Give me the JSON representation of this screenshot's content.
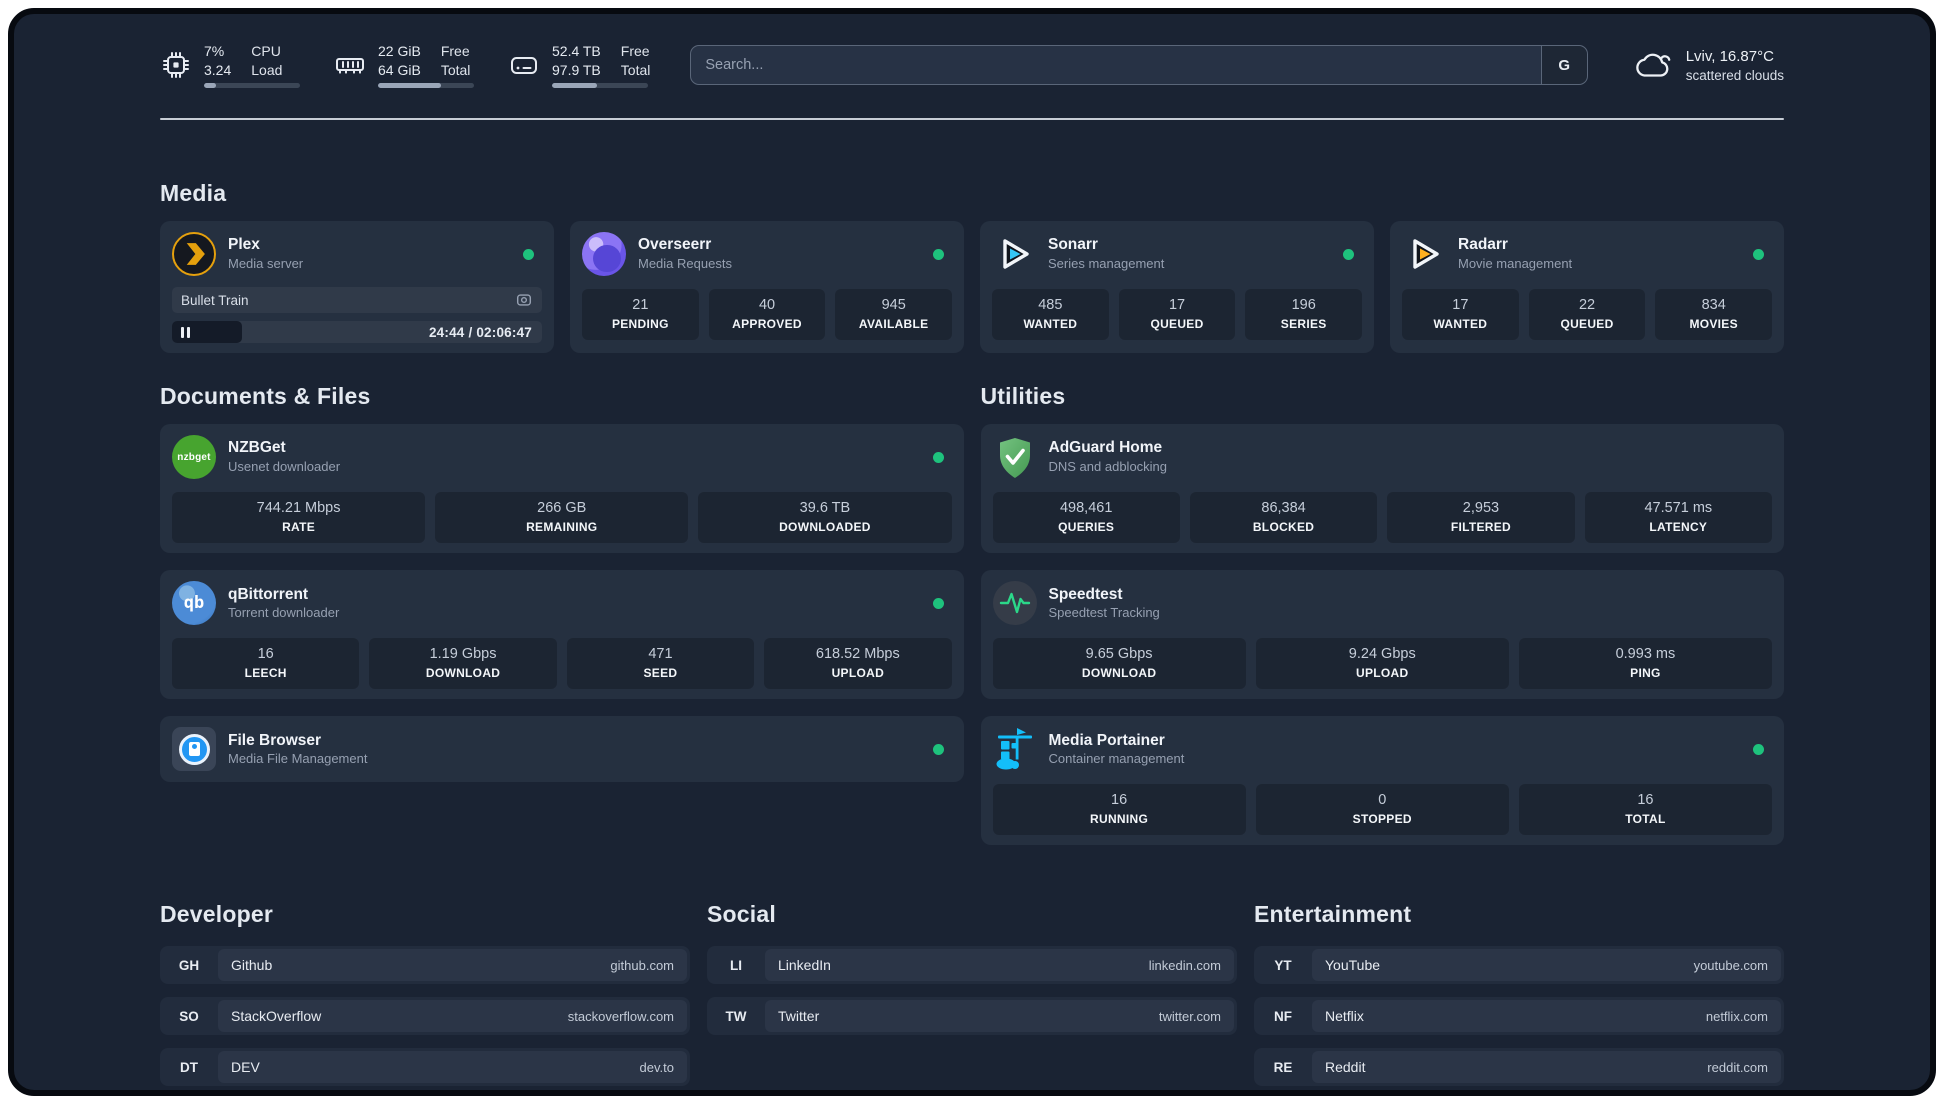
{
  "header": {
    "cpu": {
      "value1": "7%",
      "value2": "3.24",
      "label1": "CPU",
      "label2": "Load",
      "progress_pct": 12
    },
    "memory": {
      "value1": "22 GiB",
      "value2": "64 GiB",
      "label1": "Free",
      "label2": "Total",
      "progress_pct": 66
    },
    "disk": {
      "value1": "52.4 TB",
      "value2": "97.9 TB",
      "label1": "Free",
      "label2": "Total",
      "progress_pct": 47
    },
    "search": {
      "placeholder": "Search...",
      "button_label": "G"
    },
    "weather": {
      "location": "Lviv, 16.87°C",
      "condition": "scattered clouds"
    }
  },
  "media": {
    "title": "Media",
    "plex": {
      "name": "Plex",
      "subtitle": "Media server",
      "now_playing": "Bullet Train",
      "time": "24:44 / 02:06:47",
      "progress_pct": 19
    },
    "overseerr": {
      "name": "Overseerr",
      "subtitle": "Media Requests",
      "stats": [
        {
          "value": "21",
          "label": "PENDING"
        },
        {
          "value": "40",
          "label": "APPROVED"
        },
        {
          "value": "945",
          "label": "AVAILABLE"
        }
      ]
    },
    "sonarr": {
      "name": "Sonarr",
      "subtitle": "Series management",
      "stats": [
        {
          "value": "485",
          "label": "WANTED"
        },
        {
          "value": "17",
          "label": "QUEUED"
        },
        {
          "value": "196",
          "label": "SERIES"
        }
      ]
    },
    "radarr": {
      "name": "Radarr",
      "subtitle": "Movie management",
      "stats": [
        {
          "value": "17",
          "label": "WANTED"
        },
        {
          "value": "22",
          "label": "QUEUED"
        },
        {
          "value": "834",
          "label": "MOVIES"
        }
      ]
    }
  },
  "documents": {
    "title": "Documents & Files",
    "nzbget": {
      "name": "NZBGet",
      "subtitle": "Usenet downloader",
      "icon_text": "nzbget",
      "stats": [
        {
          "value": "744.21 Mbps",
          "label": "RATE"
        },
        {
          "value": "266 GB",
          "label": "REMAINING"
        },
        {
          "value": "39.6 TB",
          "label": "DOWNLOADED"
        }
      ]
    },
    "qbittorrent": {
      "name": "qBittorrent",
      "subtitle": "Torrent downloader",
      "icon_text": "qb",
      "stats": [
        {
          "value": "16",
          "label": "LEECH"
        },
        {
          "value": "1.19 Gbps",
          "label": "DOWNLOAD"
        },
        {
          "value": "471",
          "label": "SEED"
        },
        {
          "value": "618.52 Mbps",
          "label": "UPLOAD"
        }
      ]
    },
    "filebrowser": {
      "name": "File Browser",
      "subtitle": "Media File Management"
    }
  },
  "utilities": {
    "title": "Utilities",
    "adguard": {
      "name": "AdGuard Home",
      "subtitle": "DNS and adblocking",
      "stats": [
        {
          "value": "498,461",
          "label": "QUERIES"
        },
        {
          "value": "86,384",
          "label": "BLOCKED"
        },
        {
          "value": "2,953",
          "label": "FILTERED"
        },
        {
          "value": "47.571 ms",
          "label": "LATENCY"
        }
      ]
    },
    "speedtest": {
      "name": "Speedtest",
      "subtitle": "Speedtest Tracking",
      "stats": [
        {
          "value": "9.65 Gbps",
          "label": "DOWNLOAD"
        },
        {
          "value": "9.24 Gbps",
          "label": "UPLOAD"
        },
        {
          "value": "0.993 ms",
          "label": "PING"
        }
      ]
    },
    "portainer": {
      "name": "Media Portainer",
      "subtitle": "Container management",
      "stats": [
        {
          "value": "16",
          "label": "RUNNING"
        },
        {
          "value": "0",
          "label": "STOPPED"
        },
        {
          "value": "16",
          "label": "TOTAL"
        }
      ]
    }
  },
  "bookmarks": {
    "developer": {
      "title": "Developer",
      "items": [
        {
          "abbr": "GH",
          "name": "Github",
          "url": "github.com"
        },
        {
          "abbr": "SO",
          "name": "StackOverflow",
          "url": "stackoverflow.com"
        },
        {
          "abbr": "DT",
          "name": "DEV",
          "url": "dev.to"
        }
      ]
    },
    "social": {
      "title": "Social",
      "items": [
        {
          "abbr": "LI",
          "name": "LinkedIn",
          "url": "linkedin.com"
        },
        {
          "abbr": "TW",
          "name": "Twitter",
          "url": "twitter.com"
        }
      ]
    },
    "entertainment": {
      "title": "Entertainment",
      "items": [
        {
          "abbr": "YT",
          "name": "YouTube",
          "url": "youtube.com"
        },
        {
          "abbr": "NF",
          "name": "Netflix",
          "url": "netflix.com"
        },
        {
          "abbr": "RE",
          "name": "Reddit",
          "url": "reddit.com"
        }
      ]
    }
  },
  "colors": {
    "background": "#1A2333",
    "card": "#253040",
    "status_online": "#1EC27D",
    "plex_amber": "#E5A00D",
    "sonarr_cyan": "#35C5F4",
    "radarr_orange": "#FFB020",
    "nzbget_green": "#47A42F",
    "adguard_green": "#67B279",
    "qbittorrent_blue": "#4C8BD6",
    "speedtest_pulse": "#2BD889",
    "filebrowser_blue": "#2196F3",
    "portainer_blue": "#13BEF9"
  }
}
